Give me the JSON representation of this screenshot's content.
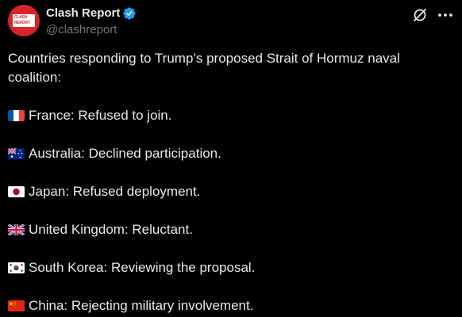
{
  "author": {
    "display_name": "Clash Report",
    "handle": "@clashreport",
    "avatar_text_line1": "CLASH",
    "avatar_text_line2": "REPORT",
    "avatar_color": "#d8232a",
    "verified": true,
    "verified_color": "#1d9bf0"
  },
  "actions": {
    "grok_icon": "grok-icon",
    "more_icon": "more-icon"
  },
  "post": {
    "intro": "Countries responding to Trump’s proposed Strait of Hormuz naval coalition:",
    "items": [
      {
        "flag": "france-flag-icon",
        "text": "France: Refused to join."
      },
      {
        "flag": "australia-flag-icon",
        "text": "Australia: Declined participation."
      },
      {
        "flag": "japan-flag-icon",
        "text": "Japan: Refused deployment."
      },
      {
        "flag": "uk-flag-icon",
        "text": "United Kingdom: Reluctant."
      },
      {
        "flag": "south-korea-flag-icon",
        "text": "South Korea: Reviewing the proposal."
      },
      {
        "flag": "china-flag-icon",
        "text": "China: Rejecting military involvement."
      }
    ]
  },
  "colors": {
    "background": "#000000",
    "text": "#e7e9ea",
    "secondary_text": "#71767b"
  }
}
